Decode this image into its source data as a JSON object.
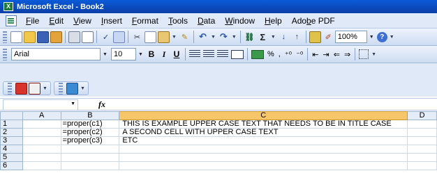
{
  "window": {
    "title": "Microsoft Excel - Book2"
  },
  "menu": {
    "items": [
      {
        "label": "File",
        "key": "file"
      },
      {
        "label": "Edit",
        "key": "edit"
      },
      {
        "label": "View",
        "key": "view"
      },
      {
        "label": "Insert",
        "key": "insert"
      },
      {
        "label": "Format",
        "key": "format"
      },
      {
        "label": "Tools",
        "key": "tools"
      },
      {
        "label": "Data",
        "key": "data"
      },
      {
        "label": "Window",
        "key": "window"
      },
      {
        "label": "Help",
        "key": "help"
      },
      {
        "label": "Adobe PDF",
        "key": "adobe-pdf"
      }
    ]
  },
  "standard_toolbar": {
    "zoom": "100%",
    "sum_symbol": "Σ",
    "help_symbol": "?"
  },
  "formatting_toolbar": {
    "font": "Arial",
    "size": "10",
    "bold": "B",
    "italic": "I",
    "underline": "U",
    "percent": "%",
    "comma": ","
  },
  "formula_bar": {
    "name_box": "",
    "fx_label": "fx",
    "content": ""
  },
  "sheet": {
    "columns": [
      "A",
      "B",
      "C",
      "D"
    ],
    "selected_column": "C",
    "rows": [
      {
        "num": "1",
        "A": "",
        "B": "=proper(c1)",
        "C": "THIS IS EXAMPLE UPPER CASE TEXT THAT NEEDS TO BE IN TITLE CASE",
        "D": ""
      },
      {
        "num": "2",
        "A": "",
        "B": "=proper(c2)",
        "C": "A SECOND CELL WITH UPPER CASE TEXT",
        "D": ""
      },
      {
        "num": "3",
        "A": "",
        "B": "=proper(c3)",
        "C": "ETC",
        "D": ""
      },
      {
        "num": "4",
        "A": "",
        "B": "",
        "C": "",
        "D": ""
      },
      {
        "num": "5",
        "A": "",
        "B": "",
        "C": "",
        "D": ""
      },
      {
        "num": "6",
        "A": "",
        "B": "",
        "C": "",
        "D": ""
      }
    ]
  },
  "icons": {
    "app": "excel-icon",
    "new": "new-document-icon",
    "open": "open-folder-icon",
    "save": "save-icon",
    "permission": "permission-icon",
    "print": "print-icon",
    "preview": "print-preview-icon",
    "spelling": "spelling-icon",
    "research": "research-icon",
    "cut": "cut-icon",
    "copy": "copy-icon",
    "paste": "paste-icon",
    "format_painter": "format-painter-icon",
    "undo": "undo-icon",
    "redo": "redo-icon",
    "hyperlink": "hyperlink-icon",
    "autosum": "autosum-icon",
    "sort_asc": "sort-ascending-icon",
    "sort_desc": "sort-descending-icon",
    "chart": "chart-wizard-icon",
    "drawing": "drawing-icon",
    "help": "help-icon",
    "pdf": "pdf-icon",
    "network": "network-icon"
  },
  "colors": {
    "title_bar": "#0a4dc2",
    "selected_header": "#f7c66b",
    "menu_bar": "#dfe9f7"
  }
}
